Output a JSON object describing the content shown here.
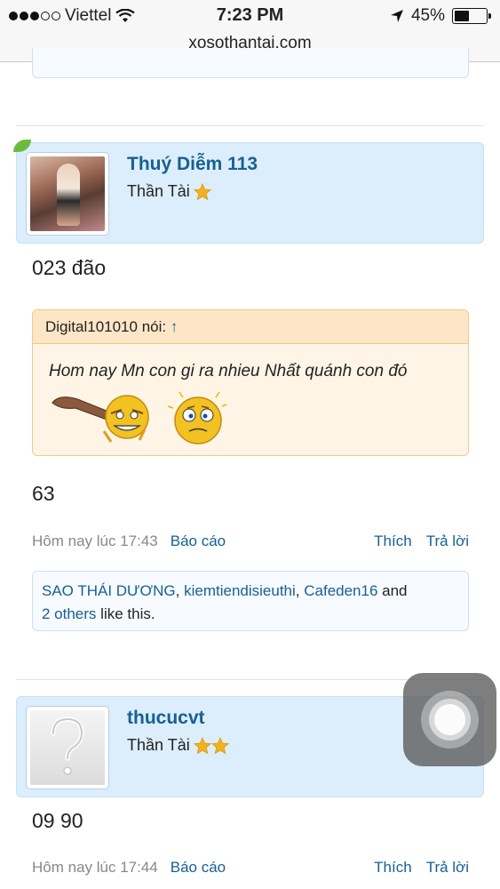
{
  "status_bar": {
    "carrier": "Viettel",
    "time": "7:23 PM",
    "battery": "45%",
    "signal_bars": 3,
    "battery_level": 0.45
  },
  "browser": {
    "url": "xosothantai.com"
  },
  "posts": [
    {
      "username": "Thuý Diễm 113",
      "user_title": "Thần Tài",
      "stars": 1,
      "text": "023 đão",
      "quote": {
        "author": "Digital101010 nói:",
        "arrow": "↑",
        "text": "Hom nay Mn con gi ra nhieu Nhất quánh con đó"
      },
      "text_after": "63",
      "date": "Hôm nay lúc 17:43",
      "report": "Báo cáo",
      "like": "Thích",
      "reply": "Trả lời",
      "likes": {
        "user1": "SAO THÁI DƯƠNG",
        "sep1": ", ",
        "user2": "kiemtiendisieuthi",
        "sep2": ", ",
        "user3": "Cafeden16",
        "and": " and",
        "others": "2 others",
        "suffix": " like this."
      }
    },
    {
      "username": "thucucvt",
      "user_title": "Thần Tài",
      "stars": 2,
      "text": "09 90",
      "date": "Hôm nay lúc 17:44",
      "report": "Báo cáo",
      "like": "Thích",
      "reply": "Trả lời"
    }
  ],
  "colors": {
    "link": "#176093",
    "post_header_bg": "#dcedfb",
    "quote_bg": "#fef5e6",
    "quote_header_bg": "#fde6c6",
    "star": "#f3b21b"
  }
}
